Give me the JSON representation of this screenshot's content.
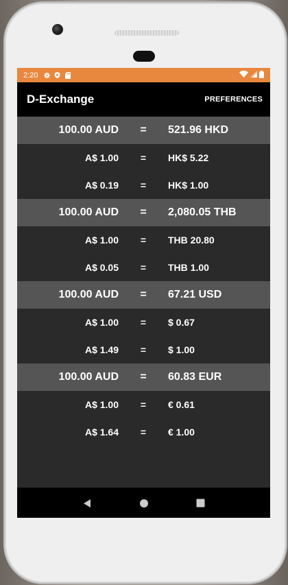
{
  "status_bar": {
    "time": "2:20",
    "accent_color": "#e8873e",
    "left_icons": [
      "settings-icon",
      "shield-icon",
      "sd-card-icon"
    ],
    "right_icons": [
      "wifi-icon",
      "signal-icon",
      "battery-icon"
    ]
  },
  "app_bar": {
    "title": "D-Exchange",
    "preferences_label": "PREFERENCES"
  },
  "rates": [
    {
      "header": {
        "left": "100.00 AUD",
        "eq": "=",
        "right": "521.96 HKD"
      },
      "rows": [
        {
          "left": "A$ 1.00",
          "eq": "=",
          "right": "HK$ 5.22"
        },
        {
          "left": "A$ 0.19",
          "eq": "=",
          "right": "HK$ 1.00"
        }
      ]
    },
    {
      "header": {
        "left": "100.00 AUD",
        "eq": "=",
        "right": "2,080.05 THB"
      },
      "rows": [
        {
          "left": "A$ 1.00",
          "eq": "=",
          "right": "THB 20.80"
        },
        {
          "left": "A$ 0.05",
          "eq": "=",
          "right": "THB 1.00"
        }
      ]
    },
    {
      "header": {
        "left": "100.00 AUD",
        "eq": "=",
        "right": "67.21 USD"
      },
      "rows": [
        {
          "left": "A$ 1.00",
          "eq": "=",
          "right": "$ 0.67"
        },
        {
          "left": "A$ 1.49",
          "eq": "=",
          "right": "$ 1.00"
        }
      ]
    },
    {
      "header": {
        "left": "100.00 AUD",
        "eq": "=",
        "right": "60.83 EUR"
      },
      "rows": [
        {
          "left": "A$ 1.00",
          "eq": "=",
          "right": "€ 0.61"
        },
        {
          "left": "A$ 1.64",
          "eq": "=",
          "right": "€ 1.00"
        }
      ]
    }
  ],
  "nav_bar": {
    "buttons": [
      "back-icon",
      "home-icon",
      "recents-icon"
    ]
  }
}
